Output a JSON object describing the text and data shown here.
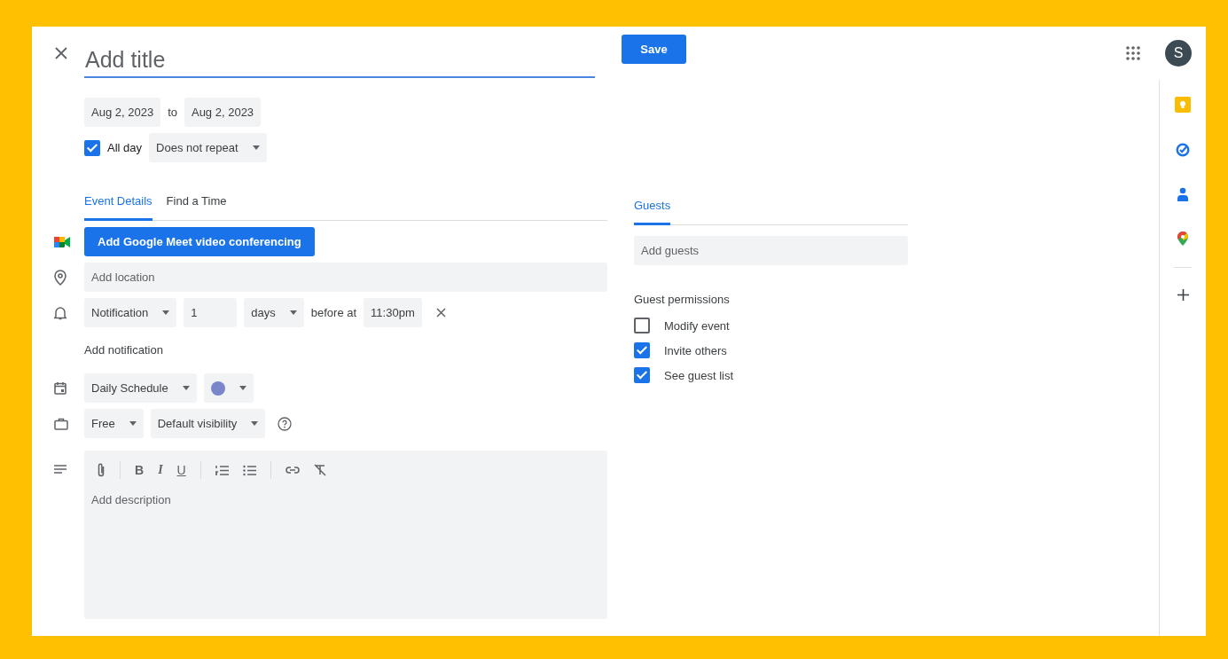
{
  "header": {
    "title_placeholder": "Add title",
    "save": "Save",
    "avatar": "S"
  },
  "dates": {
    "start": "Aug 2, 2023",
    "separator": "to",
    "end": "Aug 2, 2023"
  },
  "all_day": {
    "label": "All day",
    "checked": true
  },
  "repeat": "Does not repeat",
  "tabs": [
    {
      "label": "Event Details",
      "selected": true
    },
    {
      "label": "Find a Time",
      "selected": false
    }
  ],
  "meet_button": "Add Google Meet video conferencing",
  "location": {
    "placeholder": "Add location"
  },
  "notification": {
    "type": "Notification",
    "amount": "1",
    "unit": "days",
    "connector": "before at",
    "time": "11:30pm"
  },
  "add_notification": "Add notification",
  "calendar": {
    "name": "Daily Schedule",
    "color": "#7986cb"
  },
  "availability": "Free",
  "visibility": "Default visibility",
  "format_buttons": [
    "B",
    "I",
    "U"
  ],
  "description": {
    "placeholder": "Add description"
  },
  "guests": {
    "tab": {
      "label": "Guests",
      "selected": true
    },
    "placeholder": "Add guests",
    "permissions_title": "Guest permissions",
    "permissions": [
      {
        "label": "Modify event",
        "checked": false
      },
      {
        "label": "Invite others",
        "checked": true
      },
      {
        "label": "See guest list",
        "checked": true
      }
    ]
  }
}
